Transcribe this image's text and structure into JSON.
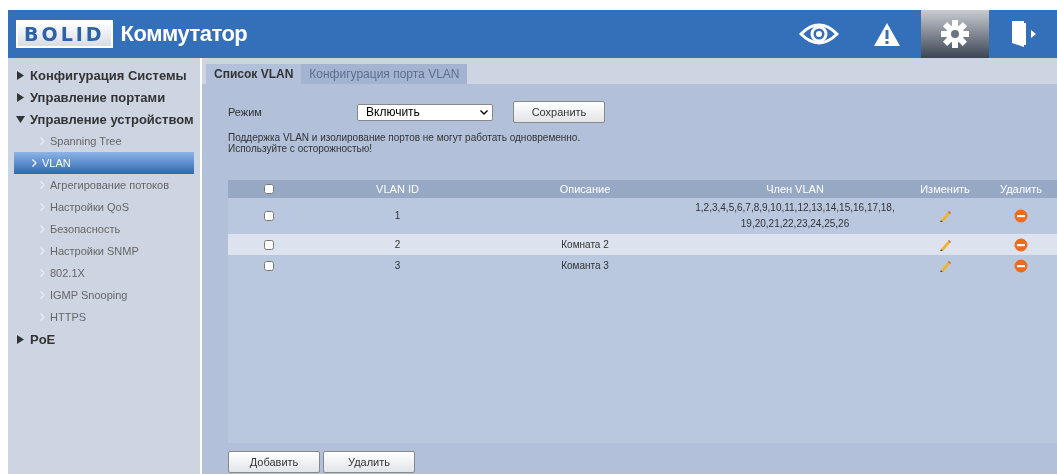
{
  "header": {
    "logo": "BOLID",
    "title": "Коммутатор",
    "nav": [
      {
        "kind": "eye",
        "selected": false
      },
      {
        "kind": "warning",
        "selected": false
      },
      {
        "kind": "gear",
        "selected": true
      },
      {
        "kind": "exit",
        "selected": false
      }
    ]
  },
  "sidebar": {
    "items": [
      {
        "label": "Конфигурация Системы",
        "expanded": false
      },
      {
        "label": "Управление портами",
        "expanded": false
      },
      {
        "label": "Управление устройством",
        "expanded": true,
        "children": [
          {
            "label": "Spanning Tree",
            "selected": false
          },
          {
            "label": "VLAN",
            "selected": true
          },
          {
            "label": "Агрегирование потоков",
            "selected": false
          },
          {
            "label": "Настройки QoS",
            "selected": false
          },
          {
            "label": "Безопасность",
            "selected": false
          },
          {
            "label": "Настройки SNMP",
            "selected": false
          },
          {
            "label": "802.1X",
            "selected": false
          },
          {
            "label": "IGMP Snooping",
            "selected": false
          },
          {
            "label": "HTTPS",
            "selected": false
          }
        ]
      },
      {
        "label": "PoE",
        "expanded": false
      }
    ]
  },
  "tabs": [
    {
      "label": "Список VLAN",
      "selected": true
    },
    {
      "label": "Конфигурация порта VLAN",
      "selected": false
    }
  ],
  "mode": {
    "label": "Режим",
    "value": "Включить",
    "save_button": "Сохранить"
  },
  "warning": "Поддержка VLAN и изолирование портов не могут работать одновременно.\nИспользуйте с осторожностью!",
  "table": {
    "header_checked": false,
    "columns": [
      "VLAN ID",
      "Описание",
      "Член VLAN",
      "Изменить",
      "Удалить"
    ],
    "rows": [
      {
        "checked": false,
        "highlighted": false,
        "id": "1",
        "description": "",
        "members": "1,2,3,4,5,6,7,8,9,10,11,12,13,14,15,16,17,18,\n19,20,21,22,23,24,25,26"
      },
      {
        "checked": false,
        "highlighted": true,
        "id": "2",
        "description": "Комната 2",
        "members": ""
      },
      {
        "checked": false,
        "highlighted": false,
        "id": "3",
        "description": "Команта 3",
        "members": ""
      }
    ]
  },
  "buttons": [
    "Добавить",
    "Удалить"
  ]
}
